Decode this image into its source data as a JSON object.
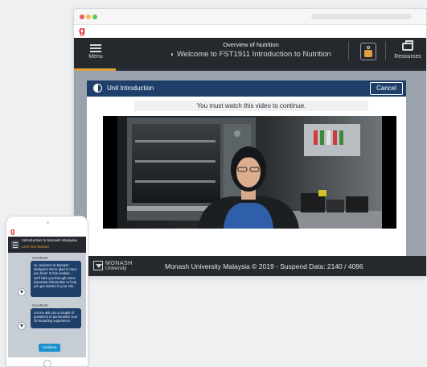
{
  "desktop": {
    "brand_logo": "g",
    "header": {
      "menu_label": "Menu",
      "title": "Overview of Nutrition",
      "subtitle": "Welcome to FST1911 Introduction to Nutrition",
      "resources_label": "Resources"
    },
    "modal": {
      "title": "Unit Introduction",
      "cancel_label": "Cancel",
      "notice": "You must watch this video to continue."
    },
    "footer": {
      "logo_name": "MONASH",
      "logo_sub": "University",
      "text": "Monash University Malaysia © 2019  - Suspend Data: 2140 / 4096"
    }
  },
  "phone": {
    "brand_logo": "g",
    "header": {
      "title": "Introduction to Monash Malaysia",
      "subtitle": "Let's Get Started"
    },
    "chat": [
      {
        "sender": "CHARLIE",
        "text": "Hi, welcome to Monash Malaysia! We're glad to have you here! In this module, we'll take you through some important information to help you get started in your role."
      },
      {
        "sender": "CHARLIE",
        "text": "Let me ask you a couple of questions to personalize your On-boarding experience."
      }
    ],
    "continue_label": "Continue"
  },
  "colors": {
    "brand_red": "#e2262d",
    "accent_orange": "#e0a23a",
    "modal_header": "#1f3f6b",
    "continue_blue": "#1c8fcf"
  }
}
